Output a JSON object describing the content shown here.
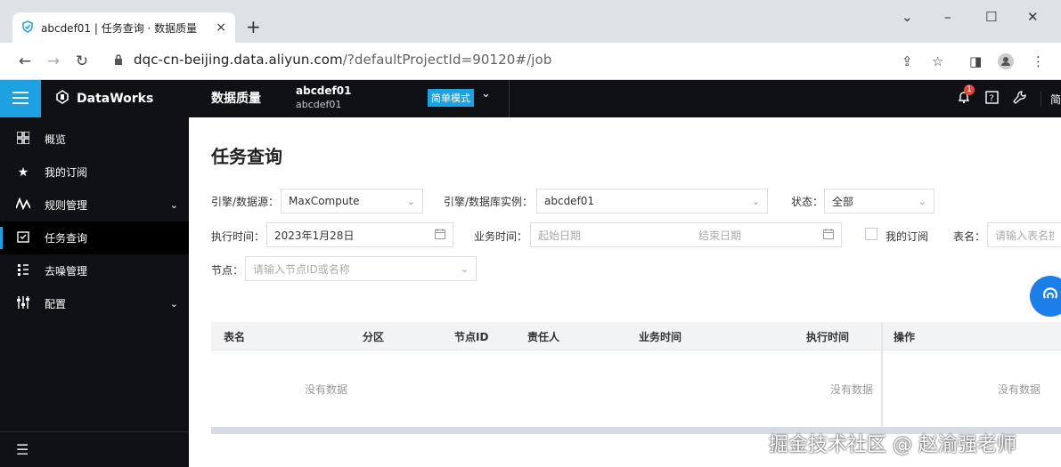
{
  "browser": {
    "tab_title": "abcdef01 | 任务查询 · 数据质量",
    "tab_close": "×",
    "new_tab": "+",
    "url_host": "dqc-cn-beijing.data.aliyun.com",
    "url_path": "/?defaultProjectId=90120#/job",
    "win_min": "–",
    "win_max": "☐",
    "win_close": "✕",
    "chevron": "⌄"
  },
  "header": {
    "brand": "DataWorks",
    "module": "数据质量",
    "project_name": "abcdef01",
    "project_sub": "abcdef01",
    "mode": "简单模式",
    "notification_count": "1",
    "extra": "简"
  },
  "sidebar": {
    "items": [
      {
        "label": "概览",
        "icon": "grid-icon",
        "glyph": "▦"
      },
      {
        "label": "我的订阅",
        "icon": "star-icon",
        "glyph": "★"
      },
      {
        "label": "规则管理",
        "icon": "pulse-icon",
        "glyph": "ʌʌ"
      },
      {
        "label": "任务查询",
        "icon": "task-icon",
        "glyph": "☑"
      },
      {
        "label": "去噪管理",
        "icon": "denoise-icon",
        "glyph": "⁞⁞"
      },
      {
        "label": "配置",
        "icon": "config-icon",
        "glyph": "⫶⫶"
      }
    ],
    "bottom": "☰"
  },
  "main": {
    "title": "任务查询",
    "filters": {
      "engine_label": "引擎/数据源：",
      "engine_value": "MaxCompute",
      "instance_label": "引擎/数据库实例：",
      "instance_value": "abcdef01",
      "status_label": "状态：",
      "status_value": "全部",
      "exec_label": "执行时间：",
      "exec_value": "2023年1月28日",
      "biz_label": "业务时间：",
      "biz_start": "起始日期",
      "biz_end": "结束日期",
      "subscribe_label": "我的订阅",
      "table_label": "表名：",
      "table_placeholder": "请输入表名搜",
      "node_label": "节点：",
      "node_placeholder": "请输入节点ID或名称"
    },
    "table": {
      "columns": [
        "表名",
        "分区",
        "节点ID",
        "责任人",
        "业务时间",
        "执行时间",
        "操作"
      ],
      "empty_text": "没有数据"
    }
  },
  "footer_watermark": "掘金技术社区 @ 赵渝强老师"
}
